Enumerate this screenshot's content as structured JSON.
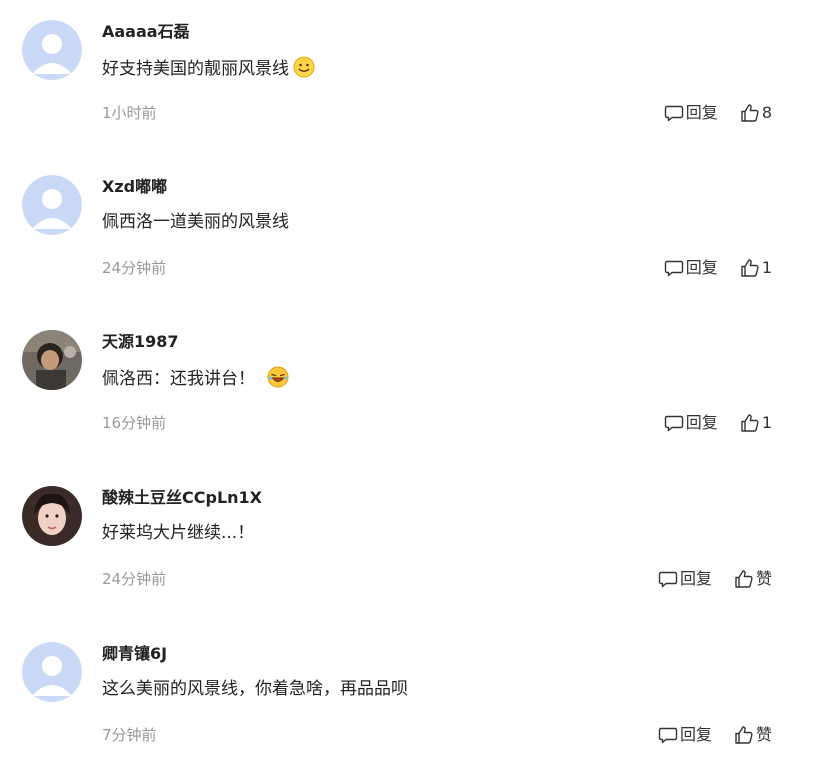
{
  "comments": [
    {
      "username": "Aaaaa石磊",
      "content": "好支持美国的靓丽风景线",
      "emoji": "smile-emoji",
      "time": "1小时前",
      "reply_label": "回复",
      "like_label": "8",
      "avatar": "default-avatar"
    },
    {
      "username": "Xzd嘟嘟",
      "content": "佩西洛一道美丽的风景线",
      "emoji": "",
      "time": "24分钟前",
      "reply_label": "回复",
      "like_label": "1",
      "avatar": "default-avatar"
    },
    {
      "username": "天源1987",
      "content": "佩洛西：还我讲台！",
      "emoji": "laugh-emoji",
      "time": "16分钟前",
      "reply_label": "回复",
      "like_label": "1",
      "avatar": "photo-avatar"
    },
    {
      "username": "酸辣土豆丝CCpLn1X",
      "content": "好莱坞大片继续...！",
      "emoji": "",
      "time": "24分钟前",
      "reply_label": "回复",
      "like_label": "赞",
      "avatar": "photo-avatar"
    },
    {
      "username": "卿青镶6J",
      "content": "这么美丽的风景线，你着急啥，再品品呗",
      "emoji": "",
      "time": "7分钟前",
      "reply_label": "回复",
      "like_label": "赞",
      "avatar": "default-avatar"
    }
  ],
  "colors": {
    "username": "#222222",
    "content": "#222222",
    "time": "#999999",
    "action": "#333333",
    "default_avatar_bg": "#c9d9f5"
  }
}
